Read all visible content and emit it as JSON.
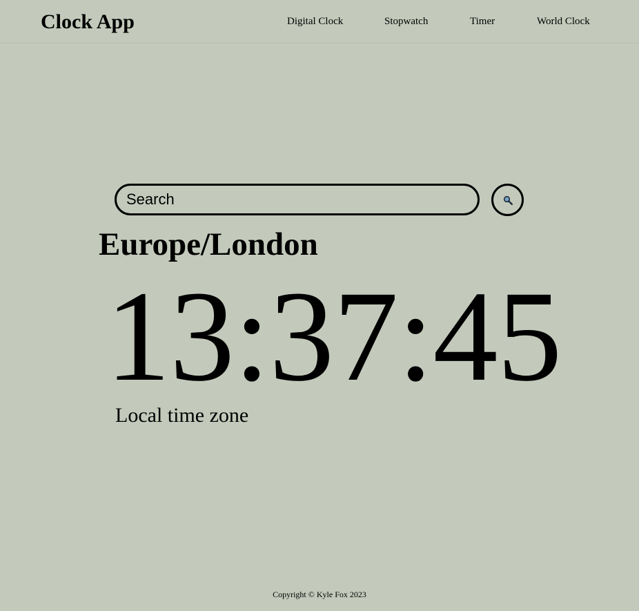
{
  "header": {
    "brand": "Clock App",
    "nav": [
      {
        "label": "Digital Clock"
      },
      {
        "label": "Stopwatch"
      },
      {
        "label": "Timer"
      },
      {
        "label": "World Clock"
      }
    ]
  },
  "search": {
    "placeholder": "Search",
    "value": "",
    "button_icon": "search-icon"
  },
  "clock": {
    "timezone": "Europe/London",
    "time": "13:37:45",
    "zone_label": "Local time zone"
  },
  "footer": {
    "copyright": "Copyright © Kyle Fox 2023"
  },
  "colors": {
    "background": "#c3cabb",
    "text": "#000000",
    "search_icon_lens": "#7aa6c8"
  }
}
